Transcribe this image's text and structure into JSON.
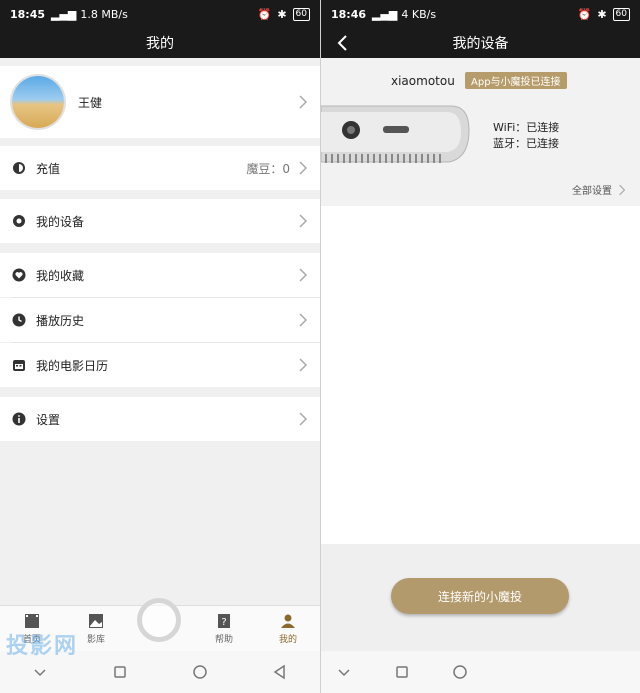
{
  "left": {
    "status": {
      "time": "18:45",
      "speed": "1.8 MB/s",
      "battery": "60"
    },
    "title": "我的",
    "profile": {
      "name": "王健"
    },
    "items": [
      {
        "label": "充值",
        "value": "魔豆：0",
        "icon": "recharge-icon"
      },
      {
        "label": "我的设备",
        "icon": "device-icon"
      },
      {
        "label": "我的收藏",
        "icon": "heart-icon"
      },
      {
        "label": "播放历史",
        "icon": "clock-icon"
      },
      {
        "label": "我的电影日历",
        "icon": "calendar-icon"
      },
      {
        "label": "设置",
        "icon": "info-icon"
      }
    ],
    "tabs": [
      {
        "label": "首页",
        "icon": "film-icon"
      },
      {
        "label": "影库",
        "icon": "gallery-icon"
      },
      {
        "label": "",
        "icon": "center-icon"
      },
      {
        "label": "帮助",
        "icon": "help-icon"
      },
      {
        "label": "我的",
        "icon": "person-icon"
      }
    ],
    "watermark": "投影网"
  },
  "right": {
    "status": {
      "time": "18:46",
      "speed": "4 KB/s",
      "battery": "60"
    },
    "title": "我的设备",
    "device_name": "xiaomotou",
    "badge": "App与小魔投已连接",
    "wifi": "WiFi：已连接",
    "bluetooth": "蓝牙：已连接",
    "all_settings": "全部设置",
    "connect_button": "连接新的小魔投"
  },
  "colors": {
    "accent": "#b39a6c",
    "dark_bar": "#1a1a1a",
    "active_tab": "#8a6a2f"
  }
}
